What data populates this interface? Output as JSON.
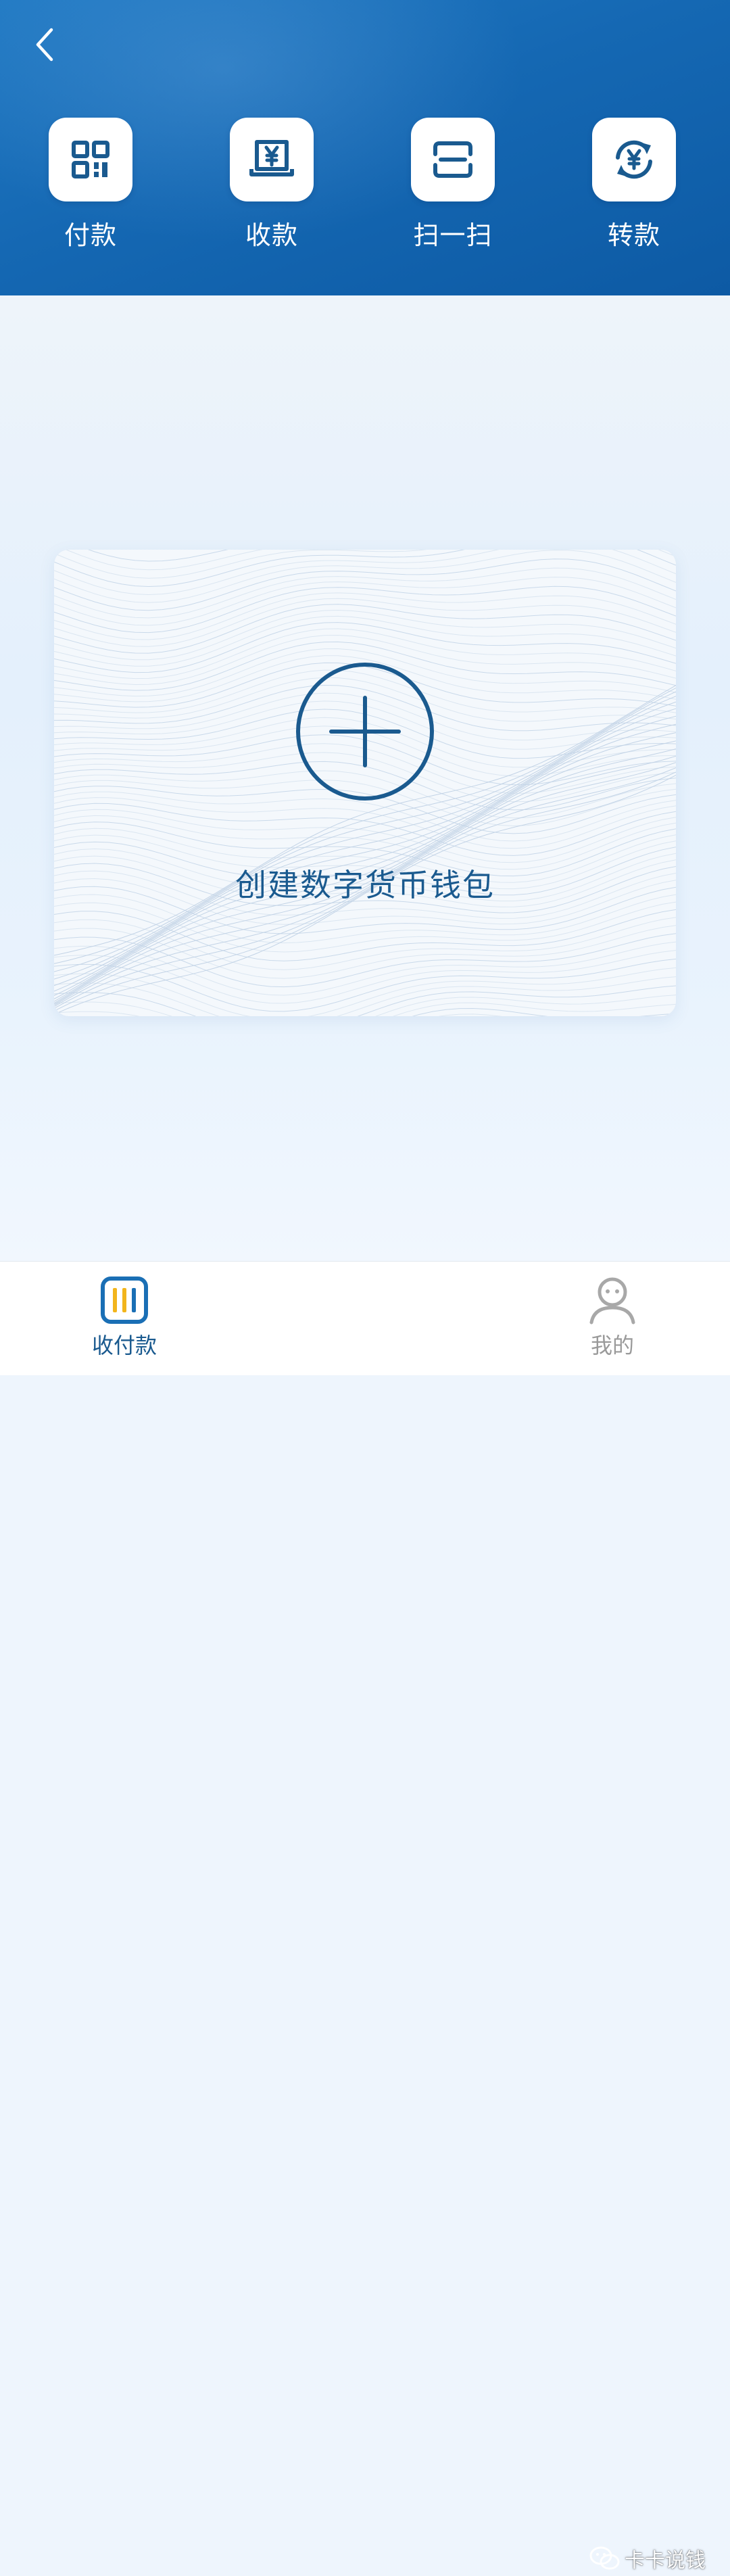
{
  "header": {
    "back_icon": "chevron-left-icon",
    "actions": [
      {
        "label": "付款",
        "icon": "qr-code-icon"
      },
      {
        "label": "收款",
        "icon": "receive-yuan-icon"
      },
      {
        "label": "扫一扫",
        "icon": "scan-icon"
      },
      {
        "label": "转款",
        "icon": "transfer-yuan-icon"
      }
    ]
  },
  "main": {
    "create_wallet": {
      "icon": "plus-circle-icon",
      "label": "创建数字货币钱包"
    }
  },
  "bottom_nav": {
    "items": [
      {
        "label": "收付款",
        "icon": "wallet-bars-icon",
        "active": true
      },
      {
        "label": "我的",
        "icon": "profile-icon",
        "active": false
      }
    ]
  },
  "watermark": {
    "text": "卡卡说钱"
  },
  "colors": {
    "header_blue": "#1568b3",
    "icon_blue": "#1a5a8f",
    "accent_yellow": "#f2b51c",
    "inactive_gray": "#9a9a9a"
  }
}
